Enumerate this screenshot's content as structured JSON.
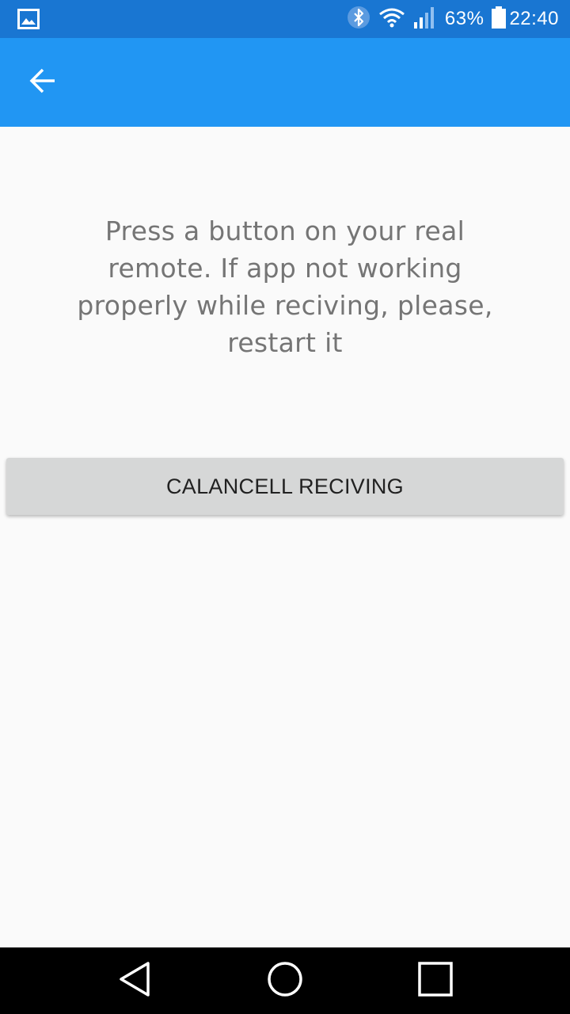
{
  "status_bar": {
    "battery_percent": "63%",
    "time": "22:40",
    "icons": [
      "gallery-notification-icon",
      "bluetooth-icon",
      "wifi-icon",
      "cell-signal-icon",
      "battery-icon"
    ]
  },
  "app_bar": {
    "back_icon": "arrow-back-icon",
    "color": "#2196f3"
  },
  "main": {
    "message": "Press a button on your real remote. If app not working properly while reciving, please, restart it",
    "cancel_button_label": "CALANCELL RECIVING"
  },
  "nav_bar": {
    "buttons": [
      "back-triangle-icon",
      "home-circle-icon",
      "recents-square-icon"
    ]
  },
  "colors": {
    "status_bar": "#1976d2",
    "app_bar": "#2196f3",
    "background": "#fafafa",
    "button": "#d6d7d7",
    "message_text": "#757575"
  }
}
